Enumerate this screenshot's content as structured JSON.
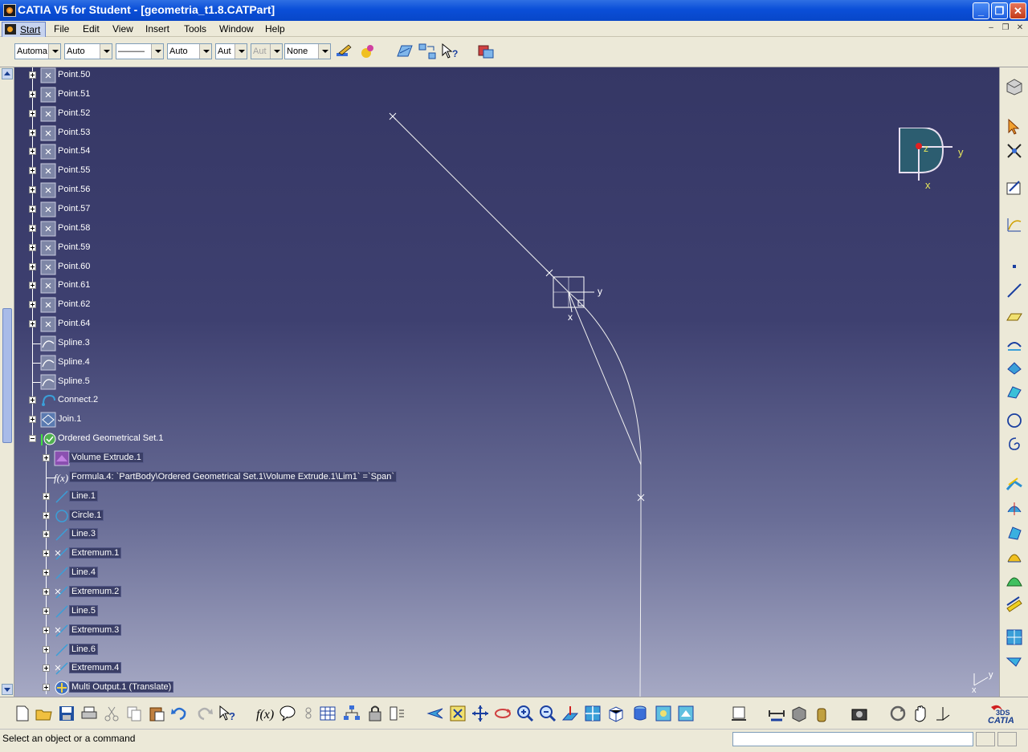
{
  "window": {
    "title": "CATIA V5 for Student - [geometria_t1.8.CATPart]",
    "minimize_glyph": "_",
    "restore_glyph": "❐",
    "close_glyph": "✕"
  },
  "menu": {
    "items": [
      "Start",
      "File",
      "Edit",
      "View",
      "Insert",
      "Tools",
      "Window",
      "Help"
    ],
    "doc_minimize_glyph": "–",
    "doc_restore_glyph": "❐",
    "doc_close_glyph": "✕"
  },
  "toolbar_top": {
    "dropdowns": [
      {
        "value": "Automa"
      },
      {
        "value": "Auto"
      },
      {
        "value": "———"
      },
      {
        "value": "Auto"
      },
      {
        "value": "Aut"
      },
      {
        "value": "Aut"
      },
      {
        "value": "None"
      }
    ]
  },
  "tree": {
    "nodes": [
      {
        "label": "Point.50",
        "icon": "point-icon"
      },
      {
        "label": "Point.51",
        "icon": "point-icon"
      },
      {
        "label": "Point.52",
        "icon": "point-icon"
      },
      {
        "label": "Point.53",
        "icon": "point-icon"
      },
      {
        "label": "Point.54",
        "icon": "point-icon"
      },
      {
        "label": "Point.55",
        "icon": "point-icon"
      },
      {
        "label": "Point.56",
        "icon": "point-icon"
      },
      {
        "label": "Point.57",
        "icon": "point-icon"
      },
      {
        "label": "Point.58",
        "icon": "point-icon"
      },
      {
        "label": "Point.59",
        "icon": "point-icon"
      },
      {
        "label": "Point.60",
        "icon": "point-icon"
      },
      {
        "label": "Point.61",
        "icon": "point-icon"
      },
      {
        "label": "Point.62",
        "icon": "point-icon"
      },
      {
        "label": "Point.64",
        "icon": "point-icon"
      },
      {
        "label": "Spline.3",
        "icon": "spline-icon"
      },
      {
        "label": "Spline.4",
        "icon": "spline-icon"
      },
      {
        "label": "Spline.5",
        "icon": "spline-icon"
      },
      {
        "label": "Connect.2",
        "icon": "connect-icon"
      },
      {
        "label": "Join.1",
        "icon": "join-icon"
      },
      {
        "label": "Ordered Geometrical Set.1",
        "icon": "ordered-set-icon"
      },
      {
        "label": "Volume Extrude.1",
        "icon": "volume-extrude-icon"
      },
      {
        "label": "Formula.4: `PartBody\\Ordered Geometrical Set.1\\Volume Extrude.1\\Lim1` =`Span`",
        "icon": "formula-icon"
      },
      {
        "label": "Line.1",
        "icon": "line-icon"
      },
      {
        "label": "Circle.1",
        "icon": "circle-icon"
      },
      {
        "label": "Line.3",
        "icon": "line-icon"
      },
      {
        "label": "Extremum.1",
        "icon": "extremum-icon"
      },
      {
        "label": "Line.4",
        "icon": "line-icon"
      },
      {
        "label": "Extremum.2",
        "icon": "extremum-icon"
      },
      {
        "label": "Line.5",
        "icon": "line-icon"
      },
      {
        "label": "Extremum.3",
        "icon": "extremum-icon"
      },
      {
        "label": "Line.6",
        "icon": "line-icon"
      },
      {
        "label": "Extremum.4",
        "icon": "extremum-icon"
      },
      {
        "label": "Multi Output.1 (Translate)",
        "icon": "multi-output-icon"
      }
    ]
  },
  "compass": {
    "label_y": "y",
    "label_x": "x",
    "label_z": "z"
  },
  "geometry": {
    "axis_label_y": "y",
    "axis_label_x": "x"
  },
  "corner_axis": {
    "label_y": "y",
    "label_x": "x"
  },
  "statusbar": {
    "message": "Select an object or a command",
    "command_value": ""
  },
  "colors": {
    "background_top": "#353765",
    "background_bottom": "#a6a9c4",
    "compass_accent": "#e8e85a",
    "highlight": "#3a3e66"
  }
}
